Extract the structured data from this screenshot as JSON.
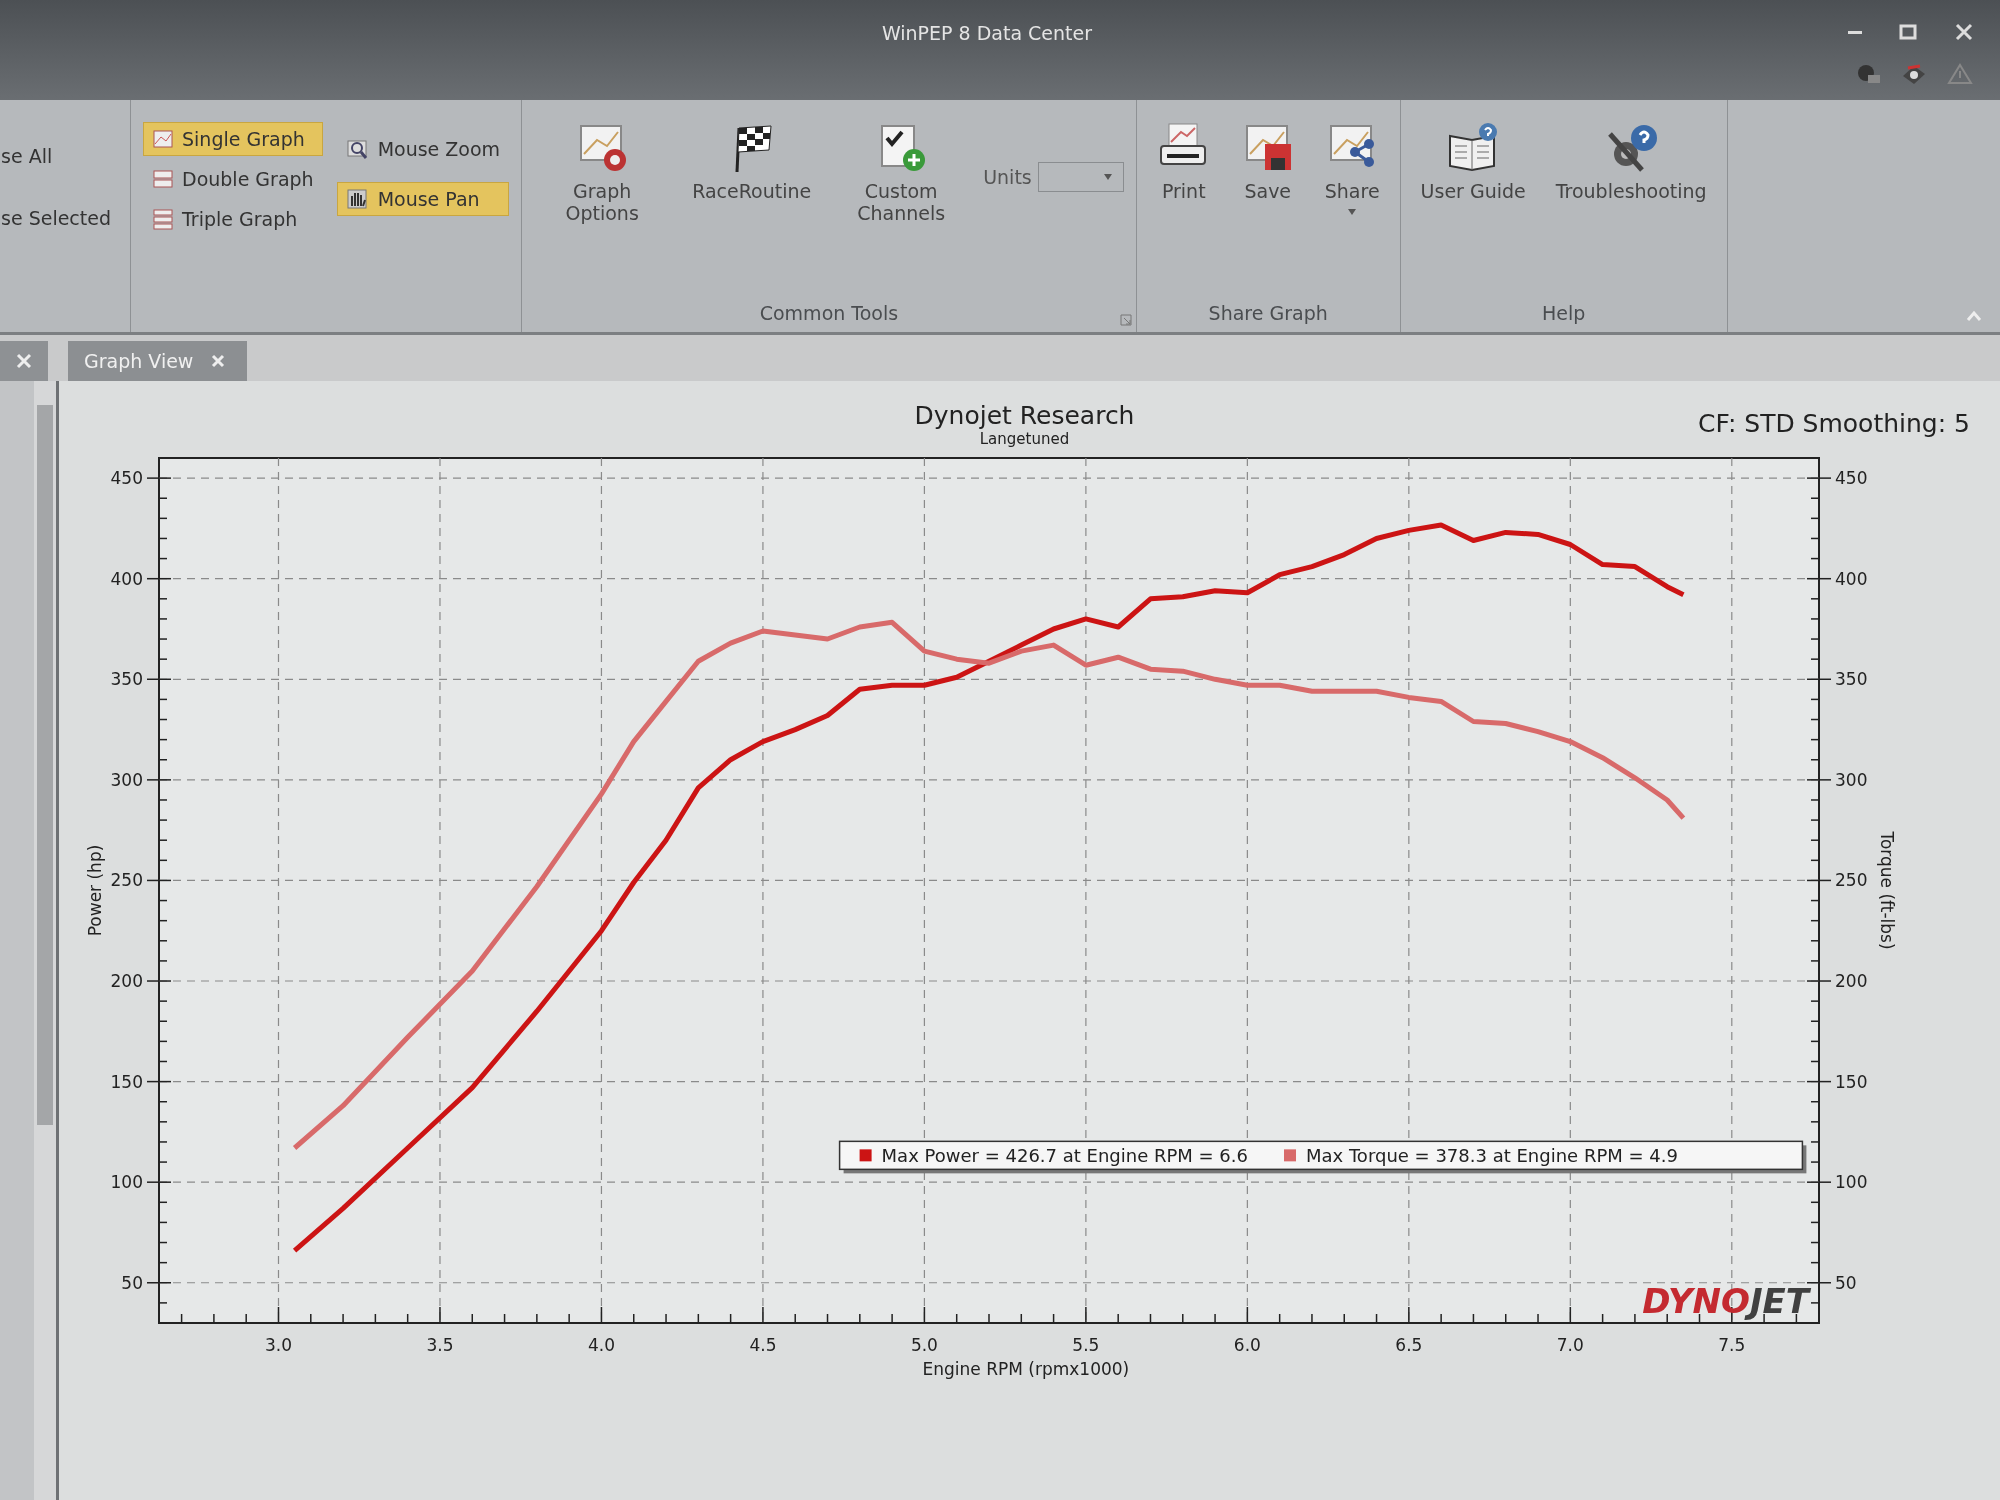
{
  "window": {
    "title": "WinPEP 8 Data Center"
  },
  "ribbon": {
    "cut_items": [
      {
        "label": "se All"
      },
      {
        "label": "se Selected"
      }
    ],
    "layout_buttons": [
      {
        "label": "Single Graph",
        "selected": true
      },
      {
        "label": "Double Graph",
        "selected": false
      },
      {
        "label": "Triple Graph",
        "selected": false
      }
    ],
    "mouse_buttons": [
      {
        "label": "Mouse Zoom",
        "selected": false
      },
      {
        "label": "Mouse Pan",
        "selected": true
      }
    ],
    "groups": [
      {
        "label": "Common Tools",
        "buttons": [
          {
            "label": "Graph Options",
            "has_menu": false
          },
          {
            "label": "RaceRoutine",
            "has_menu": false
          },
          {
            "label": "Custom Channels",
            "has_menu": false
          }
        ],
        "units": {
          "label": "Units"
        }
      },
      {
        "label": "Share Graph",
        "buttons": [
          {
            "label": "Print",
            "has_menu": false
          },
          {
            "label": "Save",
            "has_menu": false
          },
          {
            "label": "Share",
            "has_menu": true
          }
        ]
      },
      {
        "label": "Help",
        "buttons": [
          {
            "label": "User Guide",
            "has_menu": false
          },
          {
            "label": "Troubleshooting",
            "has_menu": false
          }
        ]
      }
    ]
  },
  "tabs": [
    {
      "label": "Graph View",
      "selected": true
    }
  ],
  "graph": {
    "title": "Dynojet Research",
    "subtitle": "Langetuned",
    "info": "CF: STD Smoothing: 5",
    "right_axis": {
      "label": "Torque (ft-lbs)",
      "ticks": [
        "450",
        "400",
        "350",
        "300",
        "250",
        "200",
        "150",
        "100",
        "50"
      ]
    },
    "logo": [
      "DYNO",
      "JET"
    ],
    "chart_data": {
      "type": "line",
      "grid": true,
      "legend": "lower right",
      "xlabel": "Engine RPM (rpmx1000)",
      "ylabel": "Power (hp)",
      "x": [
        3.05,
        3.2,
        3.4,
        3.6,
        3.8,
        4.0,
        4.1,
        4.2,
        4.3,
        4.4,
        4.5,
        4.6,
        4.7,
        4.8,
        4.9,
        5.0,
        5.1,
        5.2,
        5.3,
        5.4,
        5.5,
        5.6,
        5.7,
        5.8,
        5.9,
        6.0,
        6.1,
        6.2,
        6.3,
        6.4,
        6.5,
        6.6,
        6.7,
        6.8,
        6.9,
        7.0,
        7.1,
        7.2,
        7.3,
        7.35
      ],
      "series": [
        {
          "name": "Max Power = 426.7 at Engine RPM = 6.6",
          "color": "#cc1414",
          "values": [
            66,
            87,
            117,
            147,
            185,
            225,
            249,
            270,
            296,
            310,
            319,
            325,
            332,
            345,
            347,
            347,
            351,
            359,
            367,
            375,
            380,
            376,
            390,
            391,
            394,
            393,
            402,
            406,
            412,
            420,
            424,
            426.7,
            419,
            423,
            422,
            417,
            407,
            406,
            396,
            392
          ]
        },
        {
          "name": "Max Torque = 378.3 at Engine RPM = 4.9",
          "color": "#d86a6a",
          "values": [
            117,
            138,
            172,
            205,
            247,
            293,
            319,
            339,
            359,
            368,
            374,
            372,
            370,
            376,
            378.3,
            364,
            360,
            358,
            364,
            367,
            357,
            361,
            355,
            354,
            350,
            347,
            347,
            344,
            344,
            344,
            341,
            339,
            329,
            328,
            324,
            319,
            311,
            301,
            290,
            281
          ]
        }
      ],
      "xlim": [
        2.63,
        7.77
      ],
      "ylim": [
        30,
        460
      ],
      "xticks": [
        {
          "value": 3,
          "label": "3.0"
        },
        {
          "value": 3.5,
          "label": "3.5"
        },
        {
          "value": 4,
          "label": "4.0"
        },
        {
          "value": 4.5,
          "label": "4.5"
        },
        {
          "value": 5,
          "label": "5.0"
        },
        {
          "value": 5.5,
          "label": "5.5"
        },
        {
          "value": 6,
          "label": "6.0"
        },
        {
          "value": 6.5,
          "label": "6.5"
        },
        {
          "value": 7,
          "label": "7.0"
        },
        {
          "value": 7.5,
          "label": "7.5"
        }
      ],
      "yticks": [
        50,
        100,
        150,
        200,
        250,
        300,
        350,
        400,
        450
      ]
    }
  }
}
